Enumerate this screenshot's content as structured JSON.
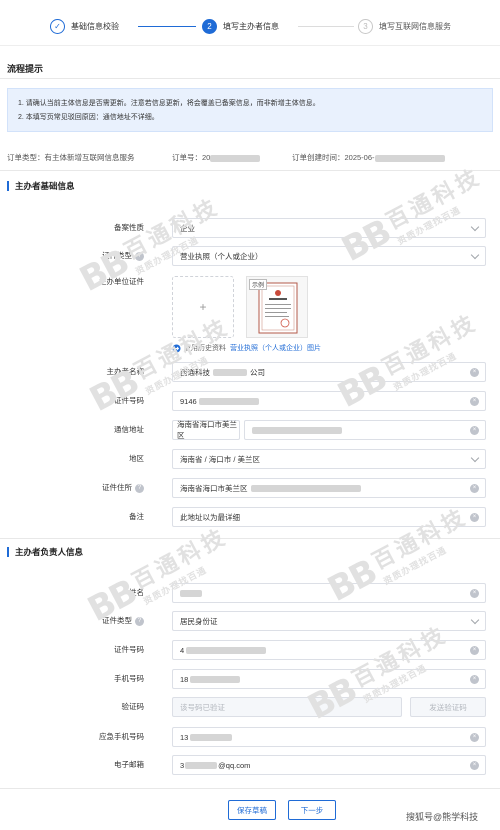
{
  "steps": [
    {
      "num": "✓",
      "label": "基础信息校验",
      "state": "done"
    },
    {
      "num": "2",
      "label": "填写主办者信息",
      "state": "active"
    },
    {
      "num": "3",
      "label": "填写互联网信息服务",
      "state": "pending"
    }
  ],
  "flow_title": "流程提示",
  "notices": [
    "1. 请确认当前主体信息是否需更新。注意若信息更新，将会覆盖已备案信息，而非新增主体信息。",
    "2. 本填写页常见驳回原因：通信地址不详细。"
  ],
  "order": {
    "type_label": "订单类型：有主体新增互联网信息服务",
    "number_label": "订单号：20",
    "created_label": "订单创建时间：2025-06-"
  },
  "sponsor": {
    "title": "主办者基础信息",
    "filing_nature_label": "备案性质",
    "filing_nature_value": "企业",
    "cert_type_label": "证件类型",
    "cert_type_value": "营业执照（个人或企业）",
    "cert_upload_label": "主办单位证件",
    "upload_plus": "+",
    "sample_tag": "示例",
    "reuse_text": "复用历史资料",
    "reuse_link": "营业执照（个人或企业）图片",
    "name_label": "主办者名称",
    "name_value_a": "西通科技",
    "name_value_b": "公司",
    "cert_no_label": "证件号码",
    "cert_no_value": "9146",
    "address_label": "通信地址",
    "address_prefix": "海南省海口市美兰区",
    "region_label": "地区",
    "region_value": "海南省 / 海口市 / 美兰区",
    "cert_addr_label": "证件住所",
    "cert_addr_value": "海南省海口市美兰区",
    "remark_label": "备注",
    "remark_value": "此地址以为最详细"
  },
  "leader": {
    "title": "主办者负责人信息",
    "name_label": "姓名",
    "cert_type_label": "证件类型",
    "cert_type_value": "居民身份证",
    "cert_no_label": "证件号码",
    "cert_no_value": "4",
    "phone_label": "手机号码",
    "phone_value": "18",
    "code_label": "验证码",
    "code_placeholder": "该号码已验证",
    "send_code": "发送验证码",
    "emergency_label": "应急手机号码",
    "emergency_value": "13",
    "email_label": "电子邮箱",
    "email_value_a": "3",
    "email_value_b": "@qq.com"
  },
  "buttons": {
    "save": "保存草稿",
    "next": "下一步"
  },
  "watermark": {
    "logo": "BB",
    "line1": "百通科技",
    "line2": "资质办理找百通"
  },
  "credit": "搜狐号@熊学科技",
  "colors": {
    "primary": "#1f6bd6",
    "notice_bg": "#e9f1fd",
    "watermark": "#e1e1e1"
  }
}
